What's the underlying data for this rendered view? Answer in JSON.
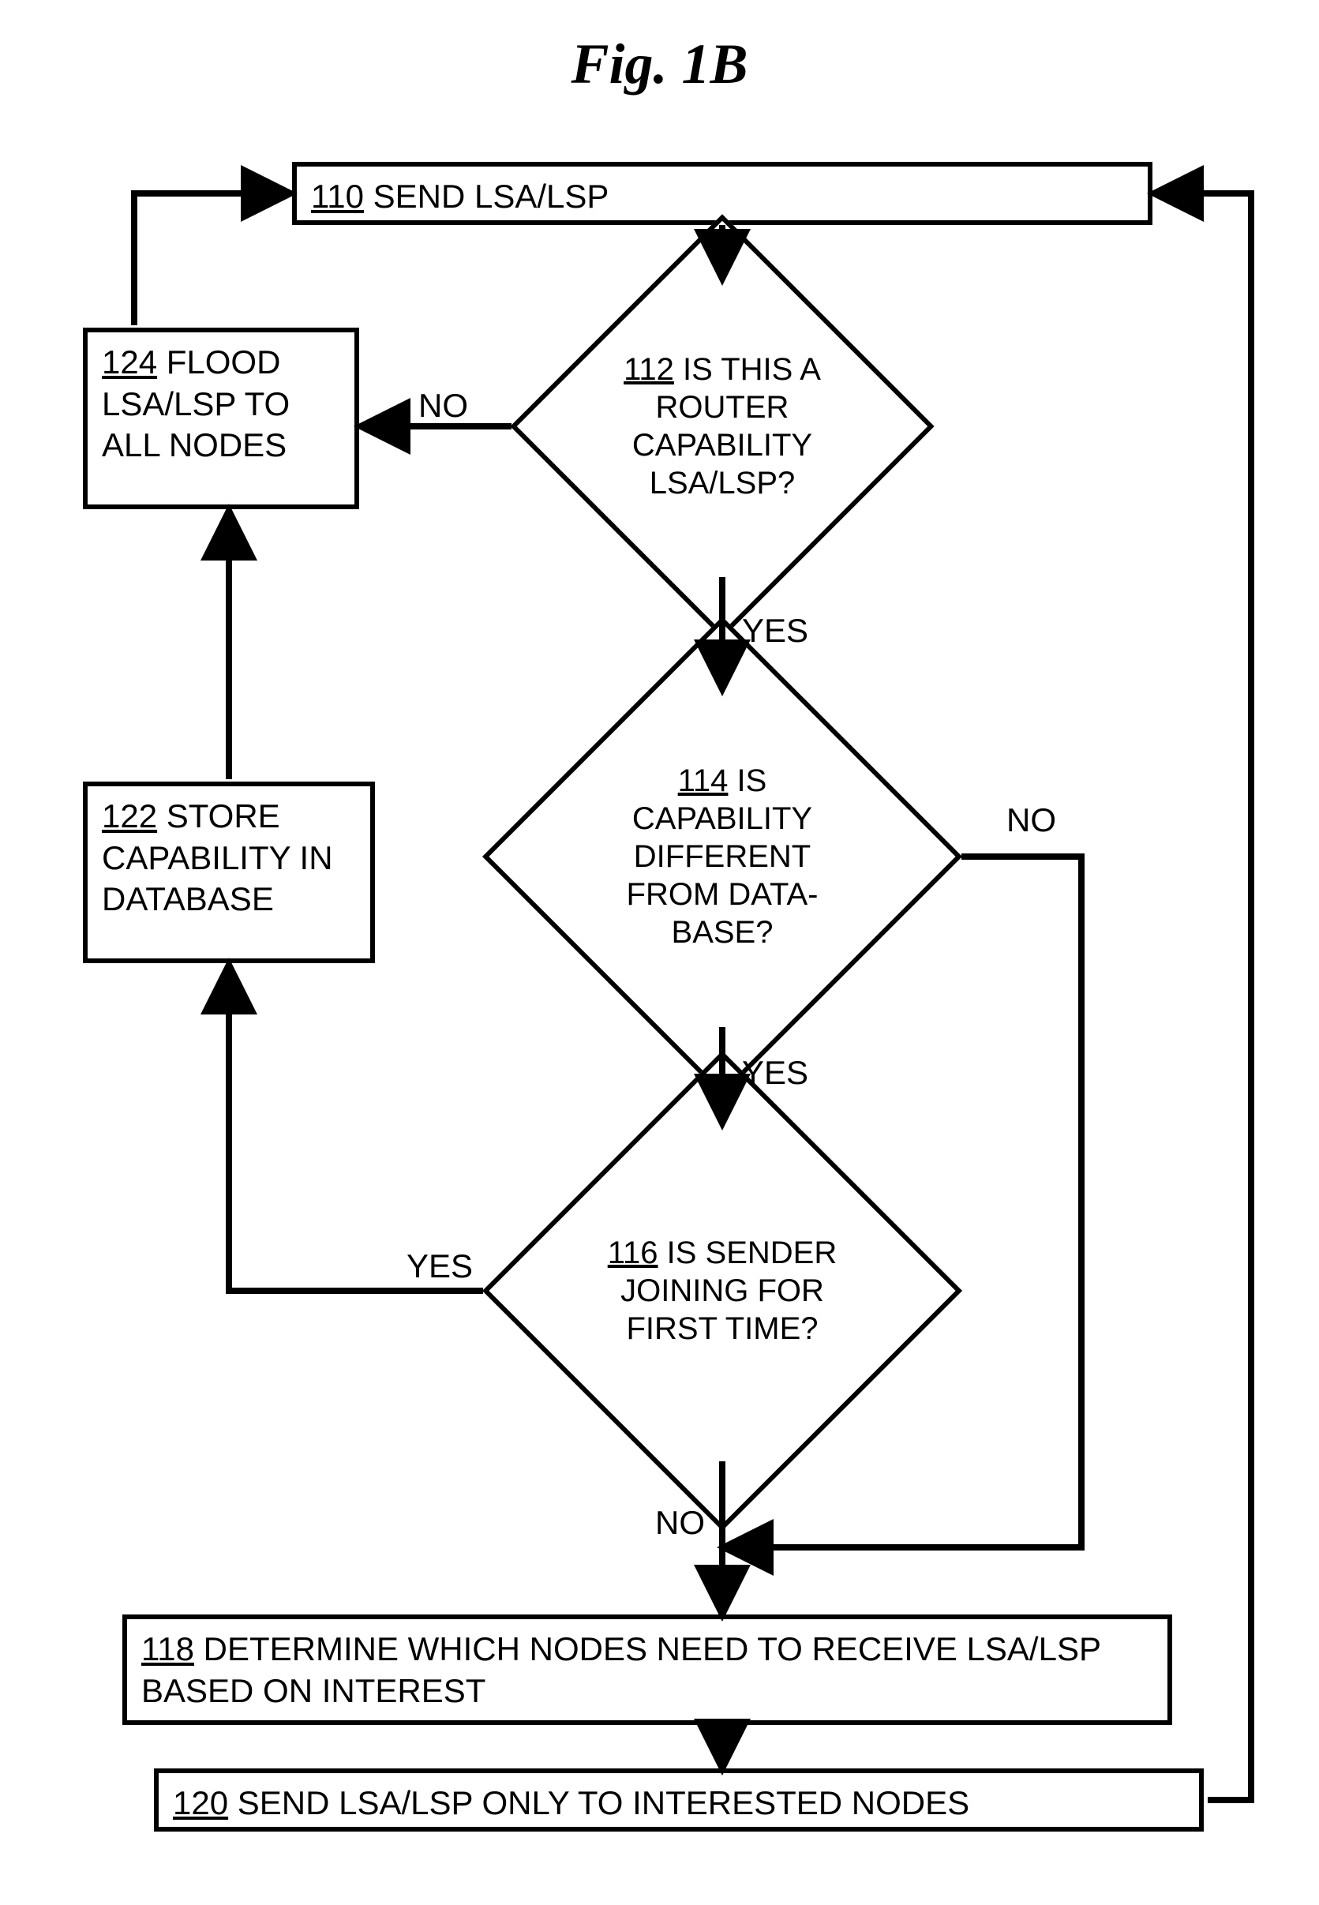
{
  "figure_title": "Fig. 1B",
  "nodes": {
    "n110": {
      "num": "110",
      "text": " SEND LSA/LSP"
    },
    "n112": {
      "num": "112",
      "text": " IS THIS A ROUTER CAPABILITY LSA/LSP?"
    },
    "n114": {
      "num": "114",
      "text": " IS CAPABILITY DIFFERENT FROM DATA-BASE?"
    },
    "n116": {
      "num": "116",
      "text": " IS SENDER JOINING FOR FIRST TIME?"
    },
    "n118": {
      "num": "118",
      "text": " DETERMINE WHICH NODES NEED TO RECEIVE LSA/LSP BASED ON INTEREST"
    },
    "n120": {
      "num": "120",
      "text": " SEND LSA/LSP ONLY TO INTERESTED NODES"
    },
    "n122": {
      "num": "122",
      "text": " STORE CAPABILITY IN DATABASE"
    },
    "n124": {
      "num": "124",
      "text": " FLOOD LSA/LSP TO ALL NODES"
    }
  },
  "labels": {
    "no_112": "NO",
    "yes_112": "YES",
    "no_114": "NO",
    "yes_114": "YES",
    "yes_116": "YES",
    "no_116": "NO"
  }
}
